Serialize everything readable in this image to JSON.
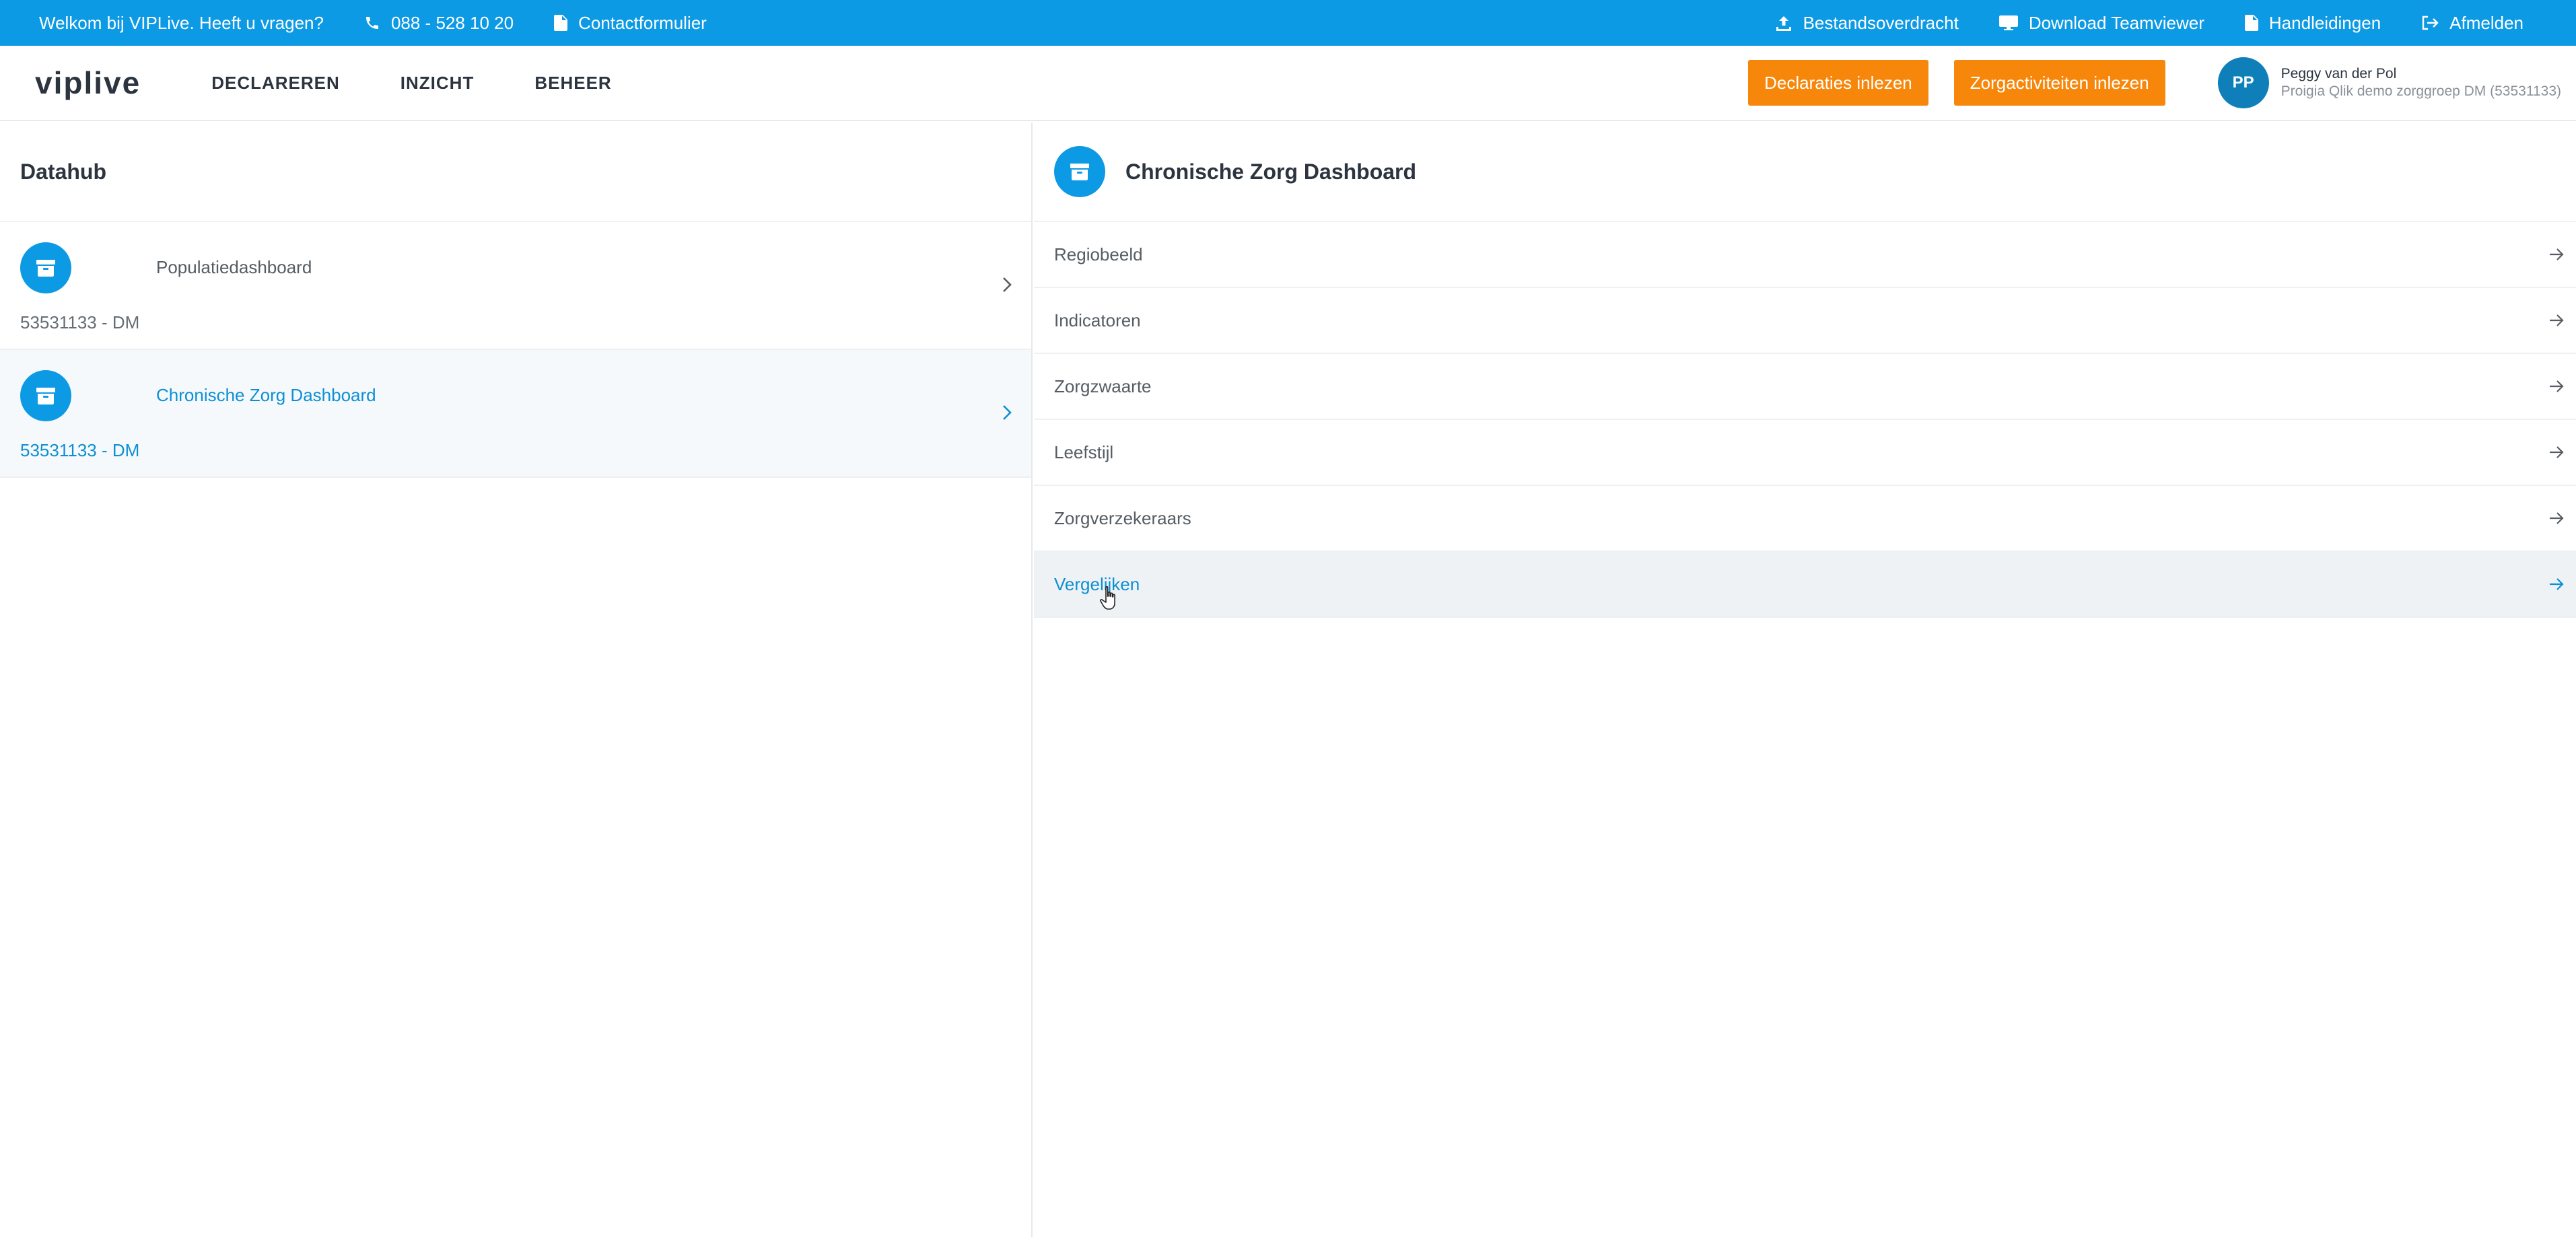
{
  "topbar": {
    "welcome": "Welkom bij VIPLive. Heeft u vragen?",
    "phone": "088 - 528 10 20",
    "contact": "Contactformulier",
    "links": [
      {
        "label": "Bestandsoverdracht",
        "icon": "upload-icon"
      },
      {
        "label": "Download Teamviewer",
        "icon": "monitor-icon"
      },
      {
        "label": "Handleidingen",
        "icon": "document-icon"
      },
      {
        "label": "Afmelden",
        "icon": "logout-icon"
      }
    ]
  },
  "header": {
    "logo": "viplive",
    "nav": [
      "DECLAREREN",
      "INZICHT",
      "BEHEER"
    ],
    "buttons": [
      "Declaraties inlezen",
      "Zorgactiviteiten inlezen"
    ],
    "user": {
      "initials": "PP",
      "name": "Peggy van der Pol",
      "org": "Proigia Qlik demo zorggroep DM (53531133)"
    }
  },
  "datahub": {
    "title": "Datahub",
    "items": [
      {
        "name": "Populatiedashboard",
        "code": "53531133 - DM",
        "active": false
      },
      {
        "name": "Chronische Zorg Dashboard",
        "code": "53531133 - DM",
        "active": true
      }
    ]
  },
  "detail": {
    "title": "Chronische Zorg Dashboard",
    "items": [
      "Regiobeeld",
      "Indicatoren",
      "Zorgzwaarte",
      "Leefstijl",
      "Zorgverzekeraars",
      "Vergelijken"
    ],
    "active_item": "Vergelijken"
  },
  "colors": {
    "topbar": "#0d9ae5",
    "accent": "#0d8fd4",
    "orange": "#f7870b",
    "avatar": "#0e7fb9"
  }
}
